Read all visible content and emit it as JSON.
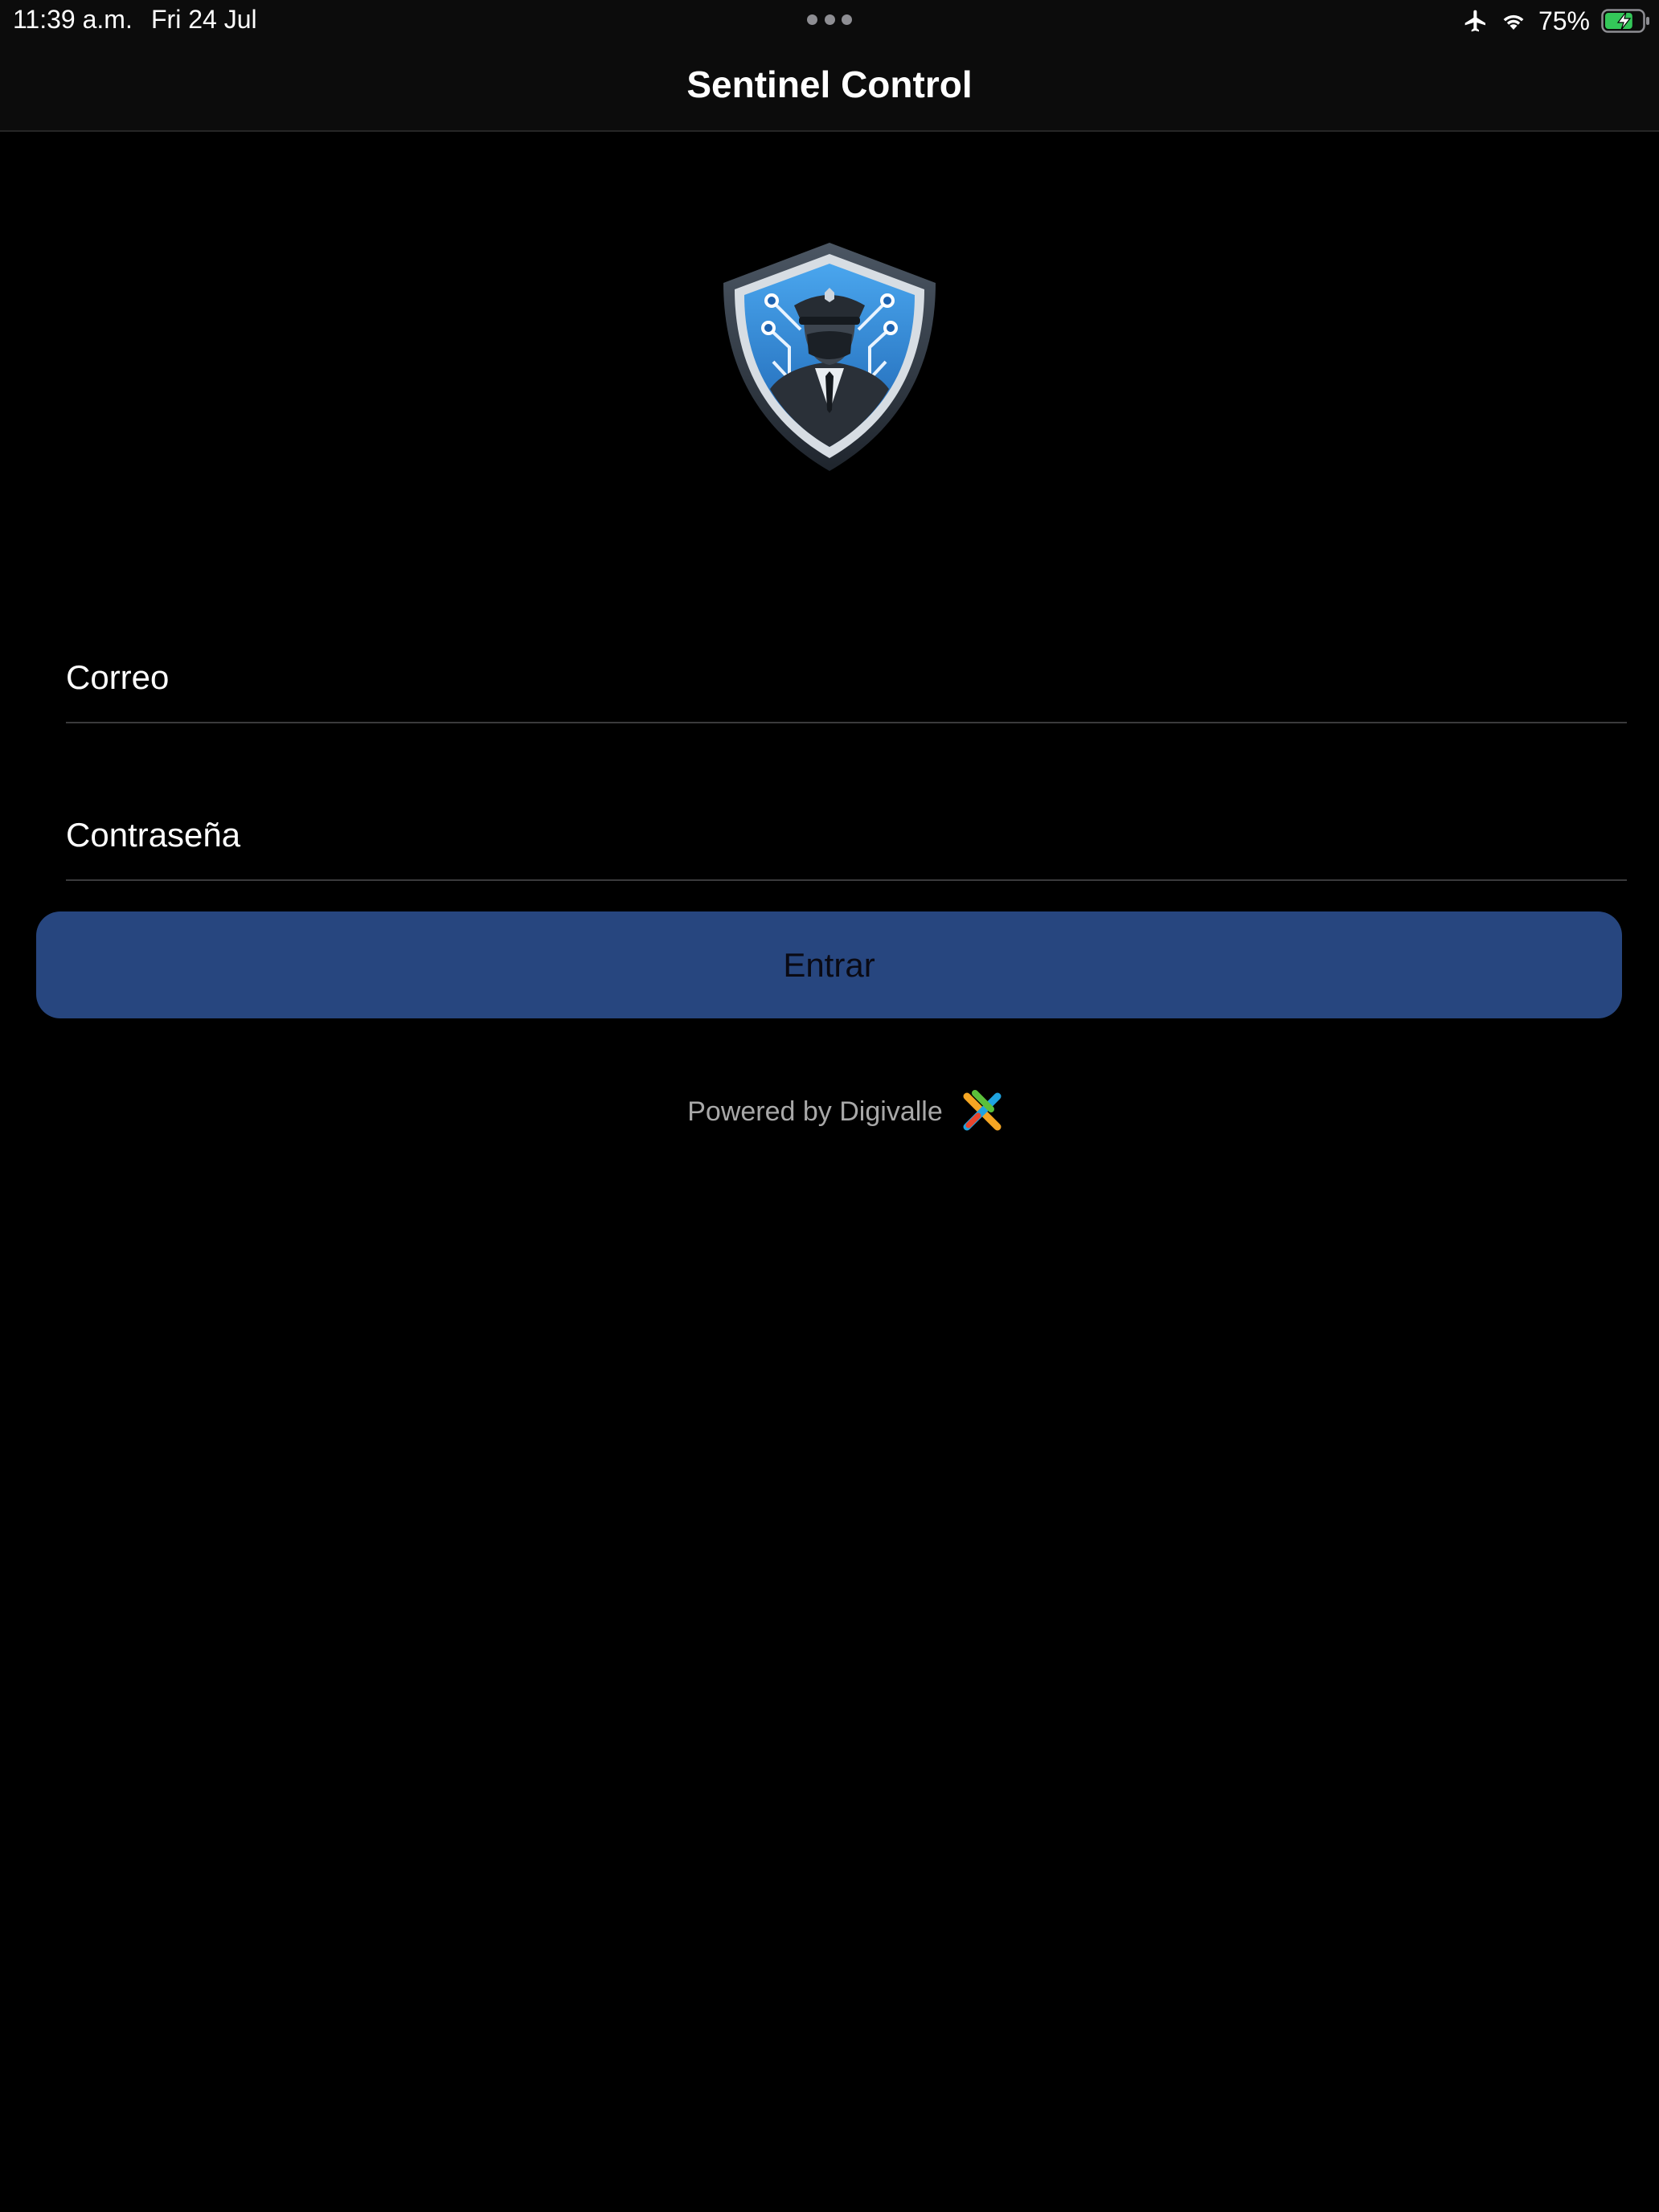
{
  "status_bar": {
    "time": "11:39 a.m.",
    "date": "Fri 24 Jul",
    "battery_percent": "75%",
    "battery_level": 0.75,
    "charging": true,
    "icons": [
      "airplane-icon",
      "wifi-icon",
      "battery-icon"
    ]
  },
  "nav": {
    "title": "Sentinel Control"
  },
  "login": {
    "email_placeholder": "Correo",
    "password_placeholder": "Contraseña",
    "submit_label": "Entrar"
  },
  "footer": {
    "powered_by": "Powered by Digivalle"
  },
  "colors": {
    "background": "#000000",
    "bar_background": "#0c0c0c",
    "button": "#27467f",
    "battery_charging": "#34c759"
  }
}
